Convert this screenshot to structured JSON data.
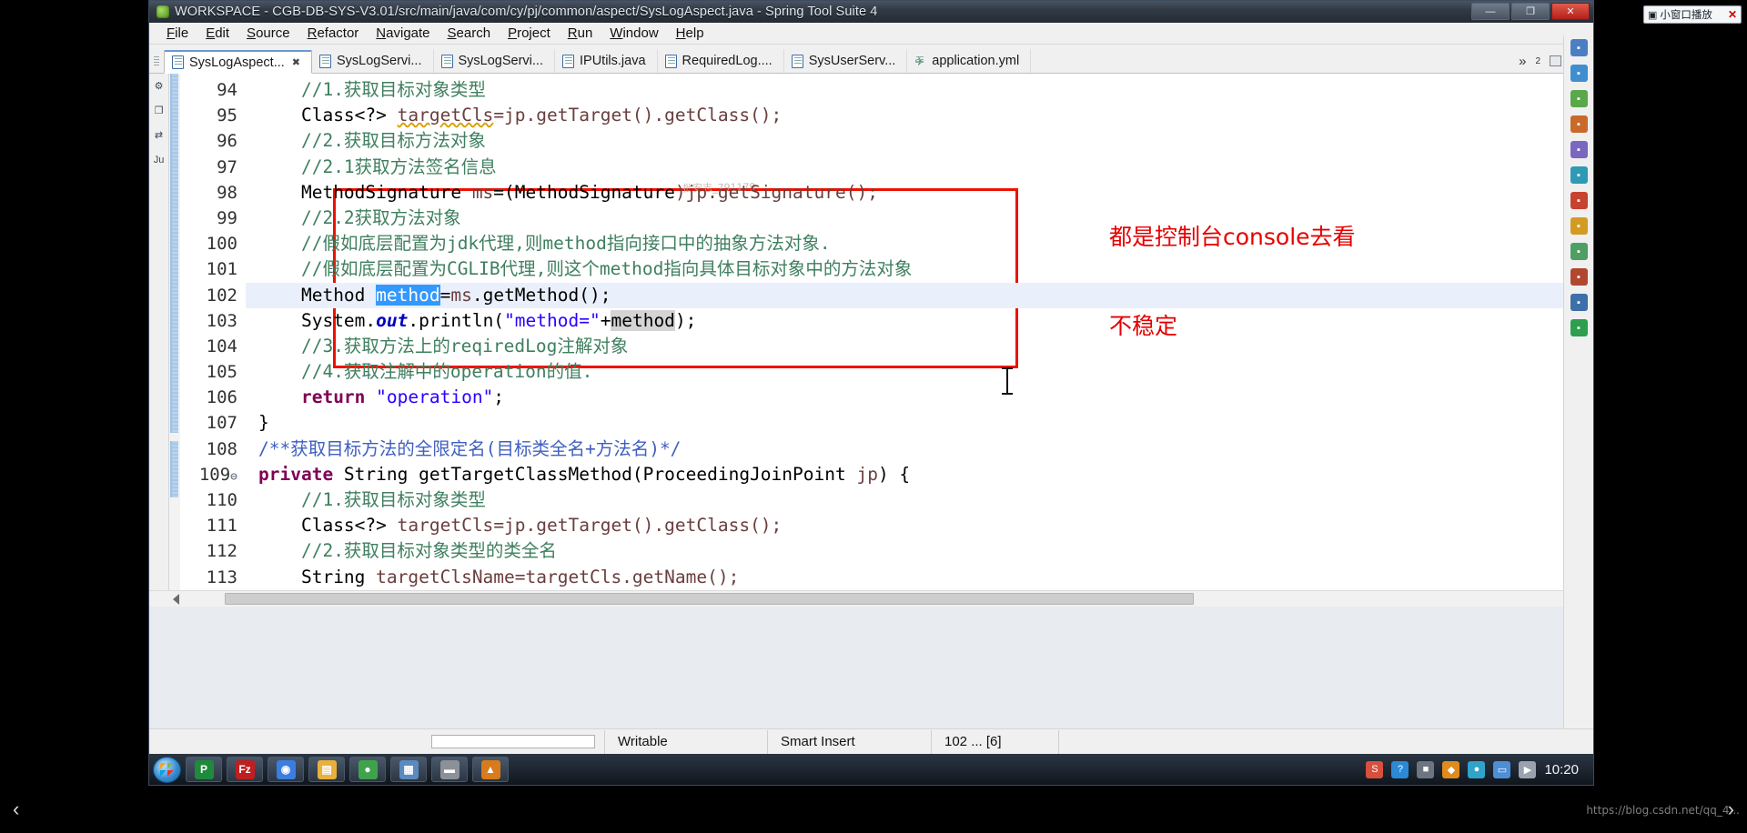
{
  "window": {
    "title": "WORKSPACE - CGB-DB-SYS-V3.01/src/main/java/com/cy/pj/common/aspect/SysLogAspect.java - Spring Tool Suite 4",
    "app_icon": "sts-leaf-icon",
    "buttons": {
      "minimize": "—",
      "maximize": "❐",
      "close": "✕"
    }
  },
  "menubar": {
    "items": [
      "File",
      "Edit",
      "Source",
      "Refactor",
      "Navigate",
      "Search",
      "Project",
      "Run",
      "Window",
      "Help"
    ]
  },
  "tabs": {
    "items": [
      {
        "label": "SysLogAspect...",
        "icon": "java-file-icon",
        "active": true,
        "closable": true
      },
      {
        "label": "SysLogServi...",
        "icon": "java-file-icon",
        "active": false,
        "closable": false
      },
      {
        "label": "SysLogServi...",
        "icon": "java-file-icon",
        "active": false,
        "closable": false
      },
      {
        "label": "IPUtils.java",
        "icon": "java-file-icon",
        "active": false,
        "closable": false
      },
      {
        "label": "RequiredLog....",
        "icon": "java-file-icon",
        "active": false,
        "closable": false
      },
      {
        "label": "SysUserServ...",
        "icon": "java-file-icon",
        "active": false,
        "closable": false
      },
      {
        "label": "application.yml",
        "icon": "yaml-file-icon",
        "active": false,
        "closable": false
      }
    ],
    "overflow_label": "»",
    "overflow_count": "2",
    "restore_label": "restore-editor",
    "maximize_label": "maximize-editor"
  },
  "left_rail": {
    "icons": [
      "outline-gear-icon",
      "copy-icon",
      "compare-icon",
      "junit-icon"
    ]
  },
  "right_rail": {
    "icons": [
      "tasks-icon",
      "package-explorer-icon",
      "spring-icon",
      "outline-icon",
      "servers-icon",
      "console-icon",
      "problems-icon",
      "boot-dashboard-icon",
      "progress-icon",
      "maven-icon",
      "terminal-icon",
      "help-icon"
    ]
  },
  "editor": {
    "first_line": 94,
    "current_line": 102,
    "lines": [
      {
        "n": 94,
        "fold": "",
        "segments": [
          {
            "t": "    ",
            "c": ""
          },
          {
            "t": "//1.获取目标对象类型",
            "c": "cmt"
          }
        ]
      },
      {
        "n": 95,
        "fold": "",
        "segments": [
          {
            "t": "    ",
            "c": ""
          },
          {
            "t": "Class<?> ",
            "c": "typ"
          },
          {
            "t": "targetCls",
            "c": "loc undl"
          },
          {
            "t": "=jp.getTarget().getClass();",
            "c": "loc"
          }
        ]
      },
      {
        "n": 96,
        "fold": "",
        "segments": [
          {
            "t": "    ",
            "c": ""
          },
          {
            "t": "//2.获取目标方法对象",
            "c": "cmt"
          }
        ]
      },
      {
        "n": 97,
        "fold": "",
        "segments": [
          {
            "t": "    ",
            "c": ""
          },
          {
            "t": "//2.1获取方法签名信息",
            "c": "cmt"
          }
        ]
      },
      {
        "n": 98,
        "fold": "",
        "segments": [
          {
            "t": "    ",
            "c": ""
          },
          {
            "t": "MethodSignature ",
            "c": "typ"
          },
          {
            "t": "ms",
            "c": "loc"
          },
          {
            "t": "=(",
            "c": "typ"
          },
          {
            "t": "MethodSignature",
            "c": "typ"
          },
          {
            "t": ")jp.getSignature();",
            "c": "loc"
          }
        ]
      },
      {
        "n": 99,
        "fold": "",
        "segments": [
          {
            "t": "    ",
            "c": ""
          },
          {
            "t": "//2.2获取方法对象",
            "c": "cmt"
          }
        ]
      },
      {
        "n": 100,
        "fold": "",
        "segments": [
          {
            "t": "    ",
            "c": ""
          },
          {
            "t": "//假如底层配置为jdk代理,则method指向接口中的抽象方法对象.",
            "c": "cmt"
          }
        ]
      },
      {
        "n": 101,
        "fold": "",
        "segments": [
          {
            "t": "    ",
            "c": ""
          },
          {
            "t": "//假如底层配置为CGLIB代理,则这个method指向具体目标对象中的方法对象",
            "c": "cmt"
          }
        ]
      },
      {
        "n": 102,
        "fold": "",
        "current": true,
        "segments": [
          {
            "t": "    ",
            "c": ""
          },
          {
            "t": "Method ",
            "c": "typ"
          },
          {
            "t": "method",
            "c": "sel"
          },
          {
            "t": "=",
            "c": "typ"
          },
          {
            "t": "ms",
            "c": "loc"
          },
          {
            "t": ".getMethod();",
            "c": "typ"
          }
        ]
      },
      {
        "n": 103,
        "fold": "",
        "segments": [
          {
            "t": "    ",
            "c": ""
          },
          {
            "t": "System.",
            "c": "typ"
          },
          {
            "t": "out",
            "c": "fld"
          },
          {
            "t": ".println(",
            "c": "typ"
          },
          {
            "t": "\"method=\"",
            "c": "str"
          },
          {
            "t": "+",
            "c": "typ"
          },
          {
            "t": "method",
            "c": "occ"
          },
          {
            "t": ");",
            "c": "typ"
          }
        ]
      },
      {
        "n": 104,
        "fold": "",
        "segments": [
          {
            "t": "    ",
            "c": ""
          },
          {
            "t": "//3.获取方法上的reqiredLog注解对象",
            "c": "cmt"
          }
        ]
      },
      {
        "n": 105,
        "fold": "",
        "segments": [
          {
            "t": "    ",
            "c": ""
          },
          {
            "t": "//4.获取注解中的operation的值.",
            "c": "cmt"
          }
        ]
      },
      {
        "n": 106,
        "fold": "",
        "segments": [
          {
            "t": "    ",
            "c": ""
          },
          {
            "t": "return ",
            "c": "kw"
          },
          {
            "t": "\"operation\"",
            "c": "str"
          },
          {
            "t": ";",
            "c": "typ"
          }
        ]
      },
      {
        "n": 107,
        "fold": "",
        "segments": [
          {
            "t": "}",
            "c": "typ"
          }
        ]
      },
      {
        "n": 108,
        "fold": "",
        "segments": [
          {
            "t": "/**获取目标方法的全限定名(目标类全名+方法名)*/",
            "c": "jdoc"
          }
        ]
      },
      {
        "n": 109,
        "fold": "⊖",
        "segments": [
          {
            "t": "private ",
            "c": "kw"
          },
          {
            "t": "String ",
            "c": "typ"
          },
          {
            "t": "getTargetClassMethod",
            "c": "typ"
          },
          {
            "t": "(ProceedingJoinPoint ",
            "c": "typ"
          },
          {
            "t": "jp",
            "c": "loc"
          },
          {
            "t": ") {",
            "c": "typ"
          }
        ]
      },
      {
        "n": 110,
        "fold": "",
        "segments": [
          {
            "t": "    ",
            "c": ""
          },
          {
            "t": "//1.获取目标对象类型",
            "c": "cmt"
          }
        ]
      },
      {
        "n": 111,
        "fold": "",
        "segments": [
          {
            "t": "    ",
            "c": ""
          },
          {
            "t": "Class<?> ",
            "c": "typ"
          },
          {
            "t": "targetCls",
            "c": "loc"
          },
          {
            "t": "=jp.getTarget().getClass();",
            "c": "loc"
          }
        ]
      },
      {
        "n": 112,
        "fold": "",
        "segments": [
          {
            "t": "    ",
            "c": ""
          },
          {
            "t": "//2.获取目标对象类型的类全名",
            "c": "cmt"
          }
        ]
      },
      {
        "n": 113,
        "fold": "",
        "segments": [
          {
            "t": "    ",
            "c": ""
          },
          {
            "t": "String ",
            "c": "typ"
          },
          {
            "t": "targetClsName",
            "c": "loc"
          },
          {
            "t": "=targetCls.getName();",
            "c": "loc"
          }
        ]
      }
    ],
    "watermark": "批安志_791179"
  },
  "annotations": {
    "red_box": {
      "label": "red-highlight-box",
      "color": "#ee1100"
    },
    "notes": [
      {
        "text": "都是控制台console去看",
        "color": "#e60000"
      },
      {
        "text": "不稳定",
        "color": "#e60000"
      }
    ]
  },
  "statusbar": {
    "writable": "Writable",
    "insert_mode": "Smart Insert",
    "position": "102 ... [6]"
  },
  "taskbar": {
    "start_label": "start-button",
    "apps": [
      {
        "name": "pycharm-taskbar-icon",
        "glyph": "P",
        "color": "#1f8a3b"
      },
      {
        "name": "filezilla-taskbar-icon",
        "glyph": "Fz",
        "color": "#bf1f1f"
      },
      {
        "name": "chrome-taskbar-icon",
        "glyph": "◉",
        "color": "#3b7de0"
      },
      {
        "name": "explorer-taskbar-icon",
        "glyph": "▤",
        "color": "#e8b13c"
      },
      {
        "name": "browser-taskbar-icon",
        "glyph": "●",
        "color": "#3fa34d"
      },
      {
        "name": "editor-taskbar-icon",
        "glyph": "▦",
        "color": "#5a8ac0"
      },
      {
        "name": "misc-taskbar-icon",
        "glyph": "▬",
        "color": "#8b9099"
      },
      {
        "name": "sts-taskbar-icon",
        "glyph": "▲",
        "color": "#d77b1c"
      }
    ],
    "tray": [
      {
        "name": "sogou-input-icon",
        "glyph": "S",
        "color": "#d94f3d"
      },
      {
        "name": "help-tray-icon",
        "glyph": "?",
        "color": "#2b8ad6"
      },
      {
        "name": "network-tray-icon",
        "glyph": "■",
        "color": "#6d7680"
      },
      {
        "name": "shield-tray-icon",
        "glyph": "◆",
        "color": "#e08b1c"
      },
      {
        "name": "security-tray-icon",
        "glyph": "●",
        "color": "#2fa3c9"
      },
      {
        "name": "monitor-tray-icon",
        "glyph": "▭",
        "color": "#4d8fd6"
      },
      {
        "name": "volume-tray-icon",
        "glyph": "▶",
        "color": "#9aa3ad"
      }
    ],
    "clock": "10:20"
  },
  "float_window": {
    "title": "小窗口播放",
    "icon": "picture-in-picture-icon",
    "close": "✕"
  },
  "overlay": {
    "prev_arrow": "‹",
    "next_arrow": "›",
    "watermark_url": "https://blog.csdn.net/qq_4..."
  }
}
